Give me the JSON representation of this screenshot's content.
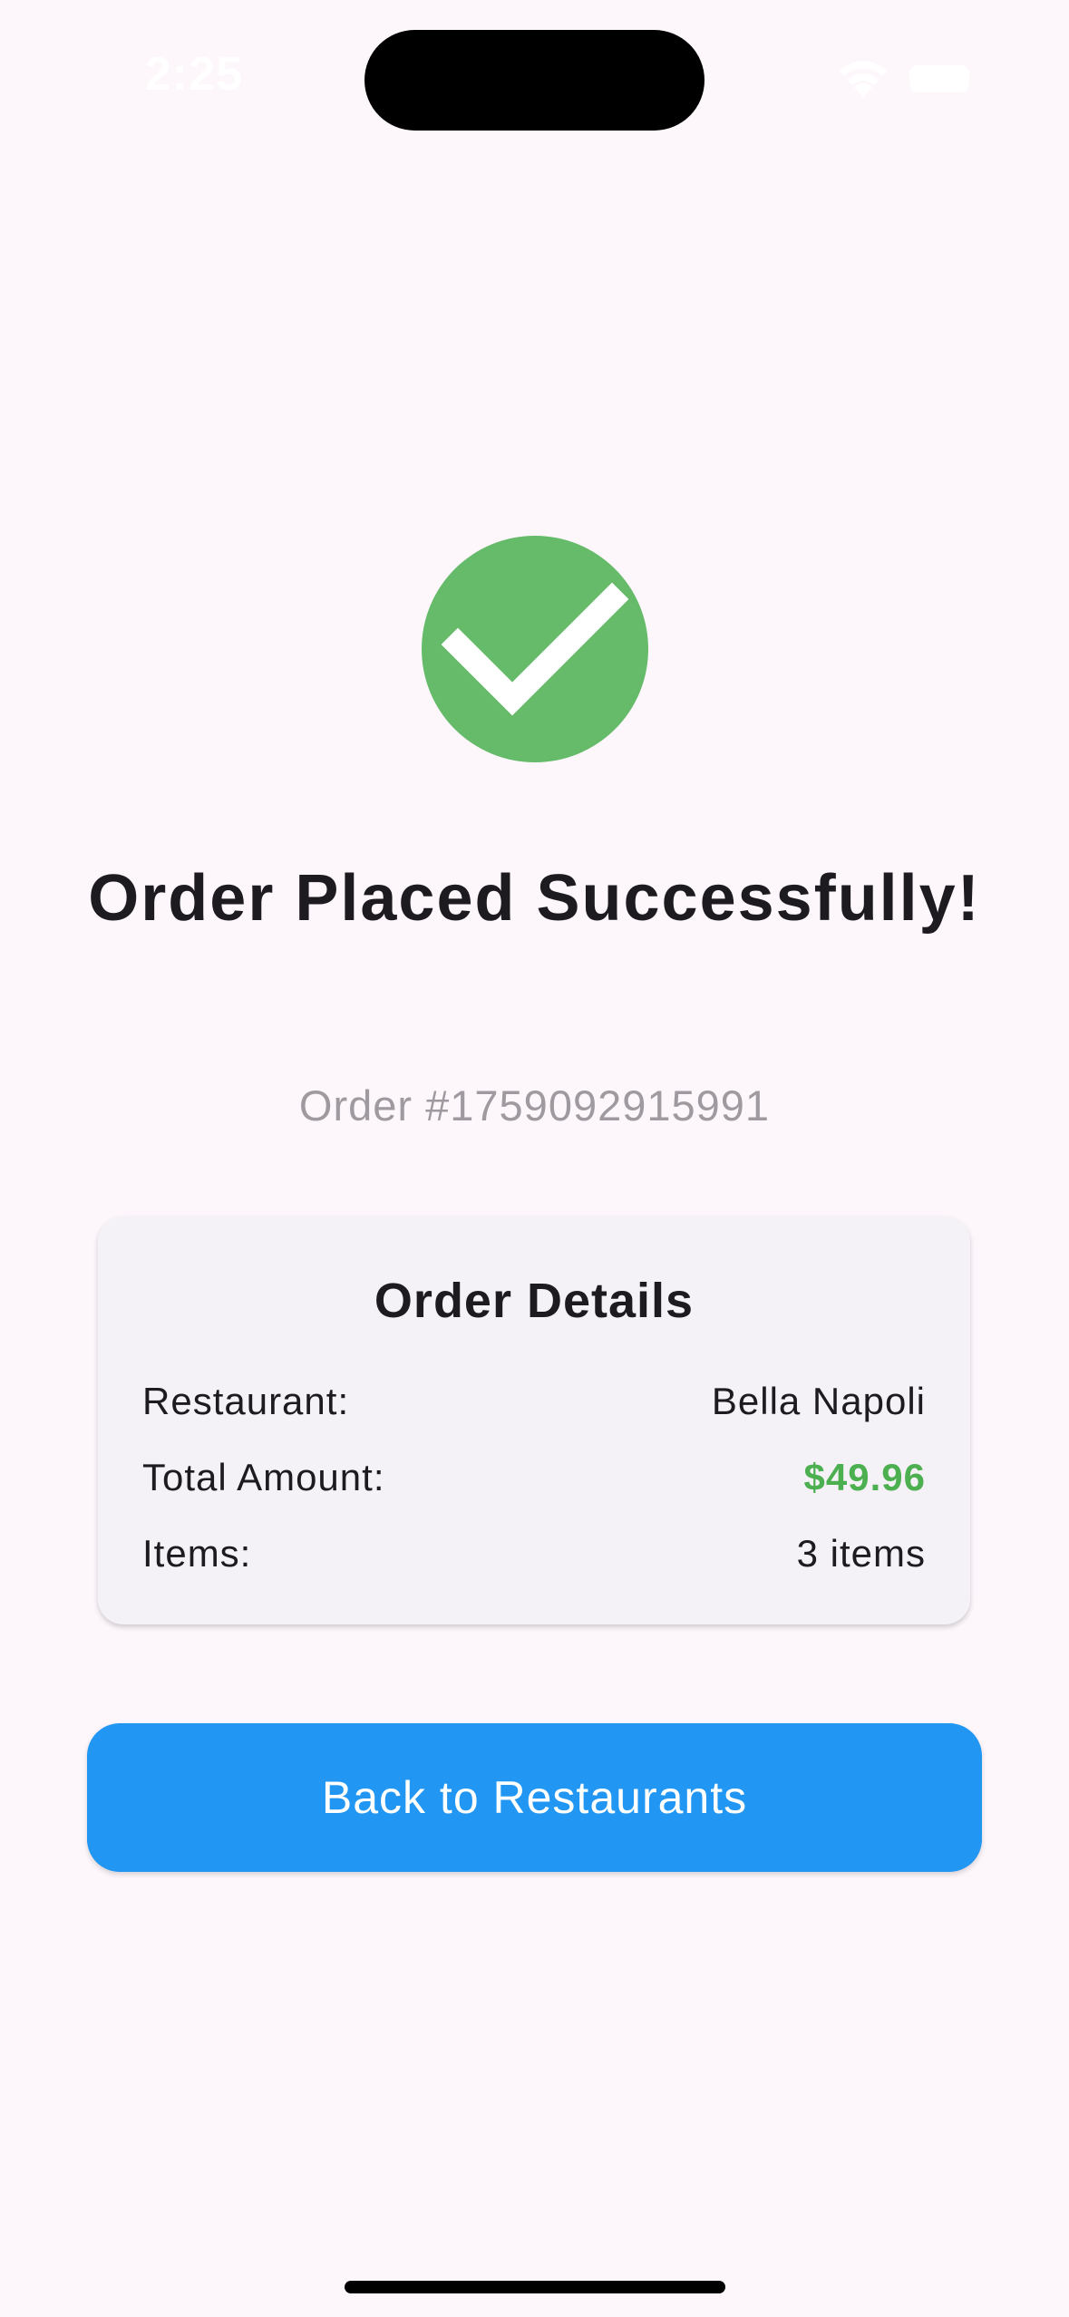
{
  "status_bar": {
    "time": "2:25",
    "wifi_icon": "wifi-icon",
    "battery_icon": "battery-icon"
  },
  "success": {
    "icon": "check-circle-icon",
    "icon_color": "#66bb6a",
    "title": "Order Placed Successfully!",
    "order_number": "Order #1759092915991"
  },
  "order_details": {
    "heading": "Order Details",
    "rows": [
      {
        "label": "Restaurant:",
        "value": "Bella Napoli"
      },
      {
        "label": "Total Amount:",
        "value": "$49.96"
      },
      {
        "label": "Items:",
        "value": "3 items"
      }
    ],
    "amount_color": "#4caf50"
  },
  "actions": {
    "back_label": "Back to Restaurants",
    "button_color": "#2196f3"
  }
}
